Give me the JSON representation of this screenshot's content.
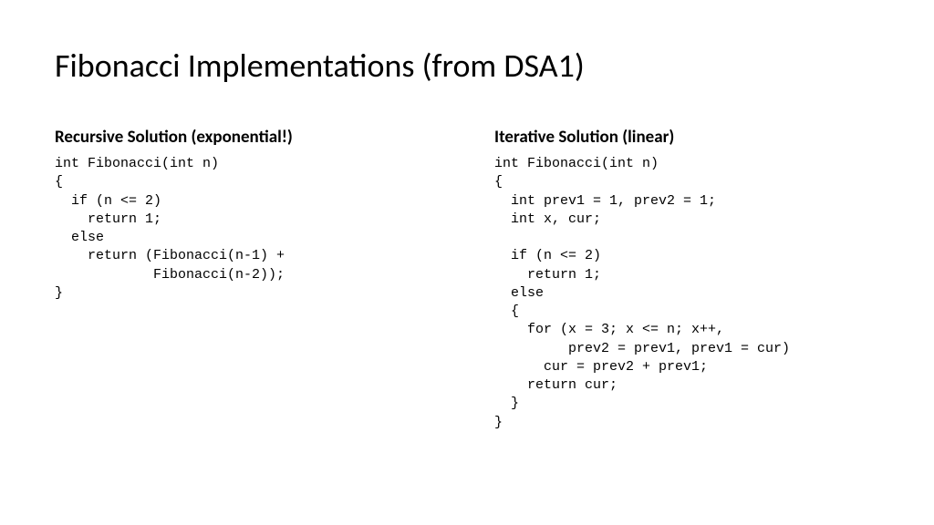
{
  "title": "Fibonacci Implementations (from DSA1)",
  "left": {
    "heading": "Recursive Solution (exponential!)",
    "code": "int Fibonacci(int n)\n{\n  if (n <= 2)\n    return 1;\n  else\n    return (Fibonacci(n-1) +\n            Fibonacci(n-2));\n}"
  },
  "right": {
    "heading": "Iterative Solution (linear)",
    "code": "int Fibonacci(int n)\n{\n  int prev1 = 1, prev2 = 1;\n  int x, cur;\n\n  if (n <= 2)\n    return 1;\n  else\n  {\n    for (x = 3; x <= n; x++,\n         prev2 = prev1, prev1 = cur)\n      cur = prev2 + prev1;\n    return cur;\n  }\n}"
  }
}
